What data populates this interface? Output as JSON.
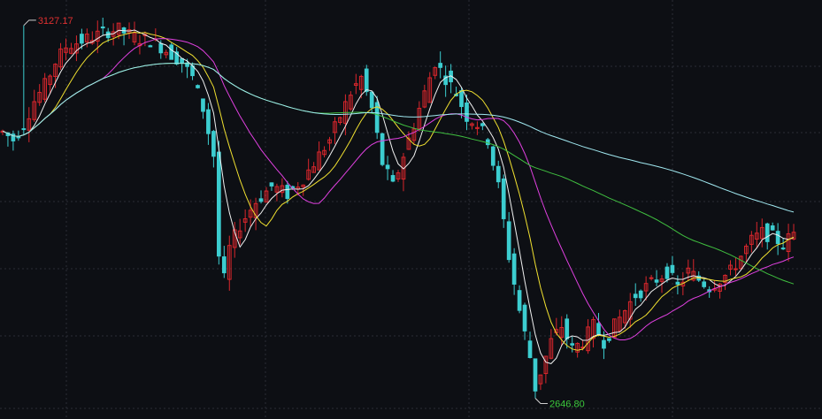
{
  "chart_data": {
    "type": "candlestick",
    "title": "",
    "xlabel": "",
    "ylabel": "",
    "grid": true,
    "ylim": [
      2620,
      3160
    ],
    "annotations": {
      "high": {
        "label": "3127.17",
        "value": 3127.17,
        "index": 4
      },
      "low": {
        "label": "2646.80",
        "value": 2646.8,
        "index": 101
      }
    },
    "colors": {
      "background": "#0d0f14",
      "grid": "#2a2d36",
      "up": "#d9262c",
      "down": "#3ccdd0",
      "high_label": "#e03030",
      "low_label": "#3cc83c",
      "ma_5": "#f0f0f0",
      "ma_10": "#f0e030",
      "ma_20": "#e040e0",
      "ma_60": "#40c040",
      "ma_120": "#a0e8f0"
    },
    "ma_series": [
      {
        "key": "ma_5",
        "period": 5,
        "color": "#f0f0f0"
      },
      {
        "key": "ma_10",
        "period": 10,
        "color": "#f0e030"
      },
      {
        "key": "ma_20",
        "period": 20,
        "color": "#e040e0"
      },
      {
        "key": "ma_60",
        "period": 60,
        "color": "#40c040"
      },
      {
        "key": "ma_120",
        "period": 120,
        "color": "#a0e8f0"
      }
    ],
    "ohlc_anchor_closes": [
      [
        0,
        2990
      ],
      [
        2,
        2980
      ],
      [
        4,
        3000
      ],
      [
        6,
        3030
      ],
      [
        8,
        3050
      ],
      [
        10,
        3080
      ],
      [
        12,
        3100
      ],
      [
        14,
        3105
      ],
      [
        16,
        3110
      ],
      [
        18,
        3115
      ],
      [
        20,
        3120
      ],
      [
        22,
        3122
      ],
      [
        24,
        3115
      ],
      [
        26,
        3110
      ],
      [
        28,
        3108
      ],
      [
        30,
        3100
      ],
      [
        32,
        3090
      ],
      [
        34,
        3080
      ],
      [
        36,
        3060
      ],
      [
        38,
        3020
      ],
      [
        40,
        2960
      ],
      [
        41,
        2830
      ],
      [
        42,
        2800
      ],
      [
        43,
        2840
      ],
      [
        45,
        2870
      ],
      [
        48,
        2900
      ],
      [
        51,
        2920
      ],
      [
        54,
        2910
      ],
      [
        57,
        2930
      ],
      [
        60,
        2960
      ],
      [
        62,
        2980
      ],
      [
        64,
        3010
      ],
      [
        66,
        3040
      ],
      [
        68,
        3060
      ],
      [
        70,
        3020
      ],
      [
        72,
        2950
      ],
      [
        74,
        2920
      ],
      [
        76,
        2960
      ],
      [
        78,
        3000
      ],
      [
        80,
        3040
      ],
      [
        82,
        3080
      ],
      [
        84,
        3060
      ],
      [
        86,
        3040
      ],
      [
        88,
        3010
      ],
      [
        90,
        3000
      ],
      [
        92,
        2980
      ],
      [
        94,
        2920
      ],
      [
        96,
        2830
      ],
      [
        98,
        2760
      ],
      [
        100,
        2700
      ],
      [
        101,
        2660
      ],
      [
        102,
        2680
      ],
      [
        104,
        2720
      ],
      [
        106,
        2740
      ],
      [
        108,
        2710
      ],
      [
        110,
        2720
      ],
      [
        112,
        2740
      ],
      [
        114,
        2720
      ],
      [
        116,
        2740
      ],
      [
        118,
        2760
      ],
      [
        120,
        2780
      ],
      [
        122,
        2790
      ],
      [
        124,
        2800
      ],
      [
        126,
        2810
      ],
      [
        128,
        2790
      ],
      [
        130,
        2810
      ],
      [
        132,
        2800
      ],
      [
        134,
        2790
      ],
      [
        136,
        2800
      ],
      [
        138,
        2810
      ],
      [
        140,
        2830
      ],
      [
        142,
        2850
      ],
      [
        144,
        2860
      ],
      [
        146,
        2855
      ],
      [
        148,
        2845
      ],
      [
        150,
        2860
      ]
    ]
  }
}
